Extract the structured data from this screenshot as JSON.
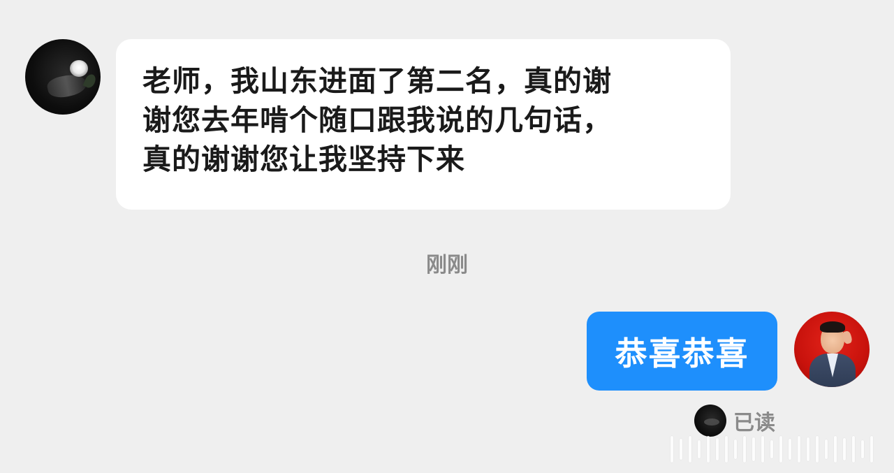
{
  "conversation": {
    "incoming_message": {
      "text": "老师，我山东进面了第二名，真的谢\n谢您去年啃个随口跟我说的几句话，\n真的谢谢您让我坚持下来"
    },
    "timestamp": "刚刚",
    "outgoing_message": {
      "text": "恭喜恭喜"
    },
    "read_receipt": {
      "label": "已读"
    }
  },
  "colors": {
    "background": "#efefef",
    "incoming_bubble": "#ffffff",
    "outgoing_bubble": "#1e8ffc",
    "muted_text": "#8a8a8a"
  },
  "icons": {
    "incoming_avatar": "avatar-dark-rose",
    "outgoing_avatar": "avatar-man-red-background",
    "read_avatar": "avatar-dark-rose-small"
  }
}
